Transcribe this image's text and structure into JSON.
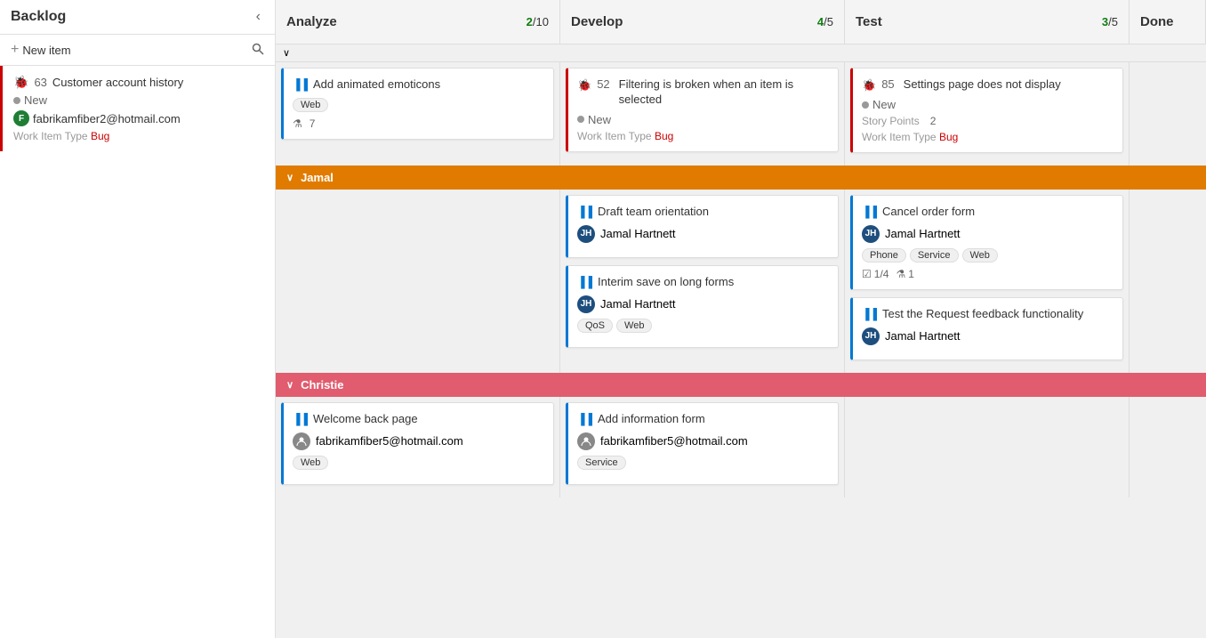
{
  "sidebar": {
    "title": "Backlog",
    "nav_back": "‹",
    "new_item_label": "New item",
    "new_item_plus": "+",
    "items": [
      {
        "id": "63",
        "title": "Customer account history",
        "status": "New",
        "assignee": "fabrikamfiber2@hotmail.com",
        "assignee_initial": "F",
        "work_item_type_label": "Work Item Type",
        "work_item_type_value": "Bug",
        "bug_icon": "🐞"
      }
    ]
  },
  "board": {
    "columns": [
      {
        "id": "analyze",
        "title": "Analyze",
        "current": "2",
        "total": "10"
      },
      {
        "id": "develop",
        "title": "Develop",
        "current": "4",
        "total": "5"
      },
      {
        "id": "test",
        "title": "Test",
        "current": "3",
        "total": "5"
      },
      {
        "id": "done",
        "title": "Done",
        "current": null,
        "total": null
      }
    ],
    "unassigned_cards": {
      "analyze": [
        {
          "id": "analyze-1",
          "number": null,
          "title": "Add animated emoticons",
          "icon_type": "story",
          "tags": [
            "Web"
          ],
          "footer_test_icon": "⚗",
          "footer_test_count": "7",
          "card_border": "blue"
        }
      ],
      "develop": [
        {
          "id": "develop-1",
          "number": "52",
          "title": "Filtering is broken when an item is selected",
          "icon_type": "bug",
          "status": "New",
          "work_item_type_label": "Work Item Type",
          "work_item_type_value": "Bug",
          "card_border": "red"
        }
      ],
      "test": [
        {
          "id": "test-1",
          "number": "85",
          "title": "Settings page does not display",
          "icon_type": "bug",
          "status": "New",
          "story_points_label": "Story Points",
          "story_points_value": "2",
          "work_item_type_label": "Work Item Type",
          "work_item_type_value": "Bug",
          "card_border": "red"
        }
      ]
    },
    "groups": [
      {
        "id": "jamal",
        "name": "Jamal",
        "color": "#e07b00",
        "cells": {
          "analyze": [],
          "develop": [
            {
              "id": "jamal-dev-1",
              "title": "Draft team orientation",
              "icon_type": "story",
              "assignee": "Jamal Hartnett",
              "assignee_initials": "JH",
              "card_border": "blue"
            },
            {
              "id": "jamal-dev-2",
              "title": "Interim save on long forms",
              "icon_type": "story",
              "assignee": "Jamal Hartnett",
              "assignee_initials": "JH",
              "tags": [
                "QoS",
                "Web"
              ],
              "card_border": "blue"
            }
          ],
          "test": [
            {
              "id": "jamal-test-1",
              "title": "Cancel order form",
              "icon_type": "story",
              "assignee": "Jamal Hartnett",
              "assignee_initials": "JH",
              "tags": [
                "Phone",
                "Service",
                "Web"
              ],
              "progress_tasks": "1/4",
              "progress_tests": "1",
              "card_border": "blue"
            },
            {
              "id": "jamal-test-2",
              "title": "Test the Request feedback functionality",
              "icon_type": "story",
              "assignee": "Jamal Hartnett",
              "assignee_initials": "JH",
              "card_border": "blue"
            }
          ],
          "done": []
        }
      },
      {
        "id": "christie",
        "name": "Christie",
        "color": "#e05c6e",
        "cells": {
          "analyze": [
            {
              "id": "christie-analyze-1",
              "title": "Welcome back page",
              "icon_type": "story",
              "assignee": "fabrikamfiber5@hotmail.com",
              "assignee_anon": true,
              "tags": [
                "Web"
              ],
              "card_border": "blue"
            }
          ],
          "develop": [
            {
              "id": "christie-dev-1",
              "title": "Add information form",
              "icon_type": "story",
              "assignee": "fabrikamfiber5@hotmail.com",
              "assignee_anon": true,
              "tags": [
                "Service"
              ],
              "card_border": "blue"
            }
          ],
          "test": [],
          "done": []
        }
      }
    ],
    "icons": {
      "story": "▐▐",
      "bug": "🐞",
      "chevron_down": "∨",
      "chevron_right": "›",
      "task": "☑",
      "test_beaker": "⚗"
    }
  }
}
